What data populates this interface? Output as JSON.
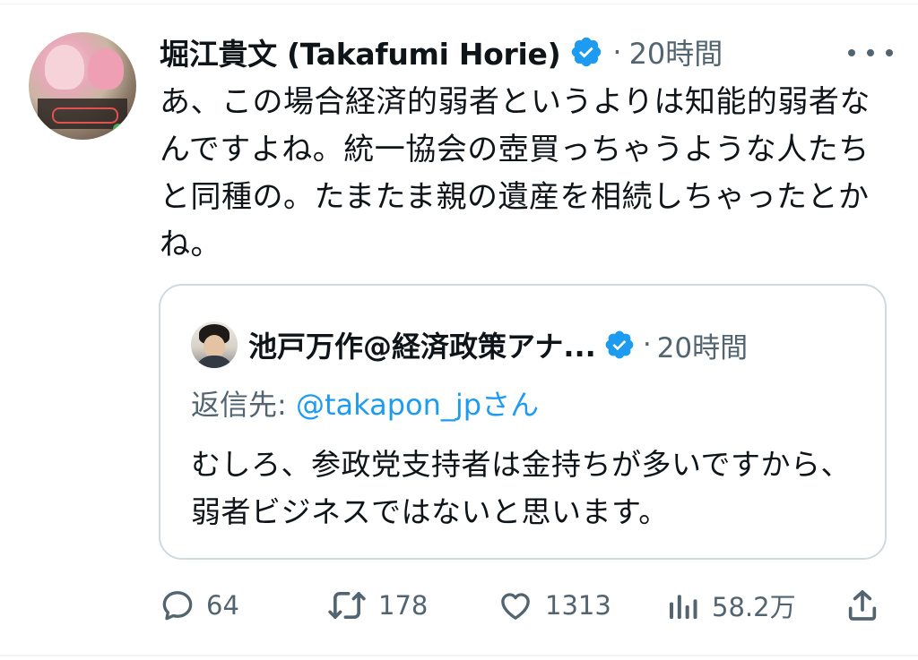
{
  "tweet": {
    "author_name": "堀江貴文 (Takafumi Horie)",
    "time": "20時間",
    "separator": "·",
    "text": "あ、この場合経済的弱者というよりは知能的弱者なんですよね。統一協会の壺買っちゃうような人たちと同種の。たまたま親の遺産を相続しちゃったとかね。"
  },
  "quote": {
    "author_name": "池戸万作@経済政策アナ...",
    "time": "20時間",
    "separator": "·",
    "reply_prefix": "返信先: ",
    "reply_handle": "@takapon_jp",
    "reply_suffix": "さん",
    "text": "むしろ、参政党支持者は金持ちが多いですから、弱者ビジネスではないと思います。"
  },
  "actions": {
    "replies": "64",
    "retweets": "178",
    "likes": "1313",
    "views": "58.2万"
  },
  "icons": {
    "verified": "verified-badge-icon",
    "more": "more-dots-icon",
    "reply": "reply-icon",
    "retweet": "retweet-icon",
    "like": "heart-icon",
    "views": "views-bar-icon",
    "share": "share-icon"
  },
  "colors": {
    "verified": "#1d9bf0",
    "link": "#1d9bf0",
    "secondary_text": "#536471",
    "border": "#cfd9de"
  }
}
